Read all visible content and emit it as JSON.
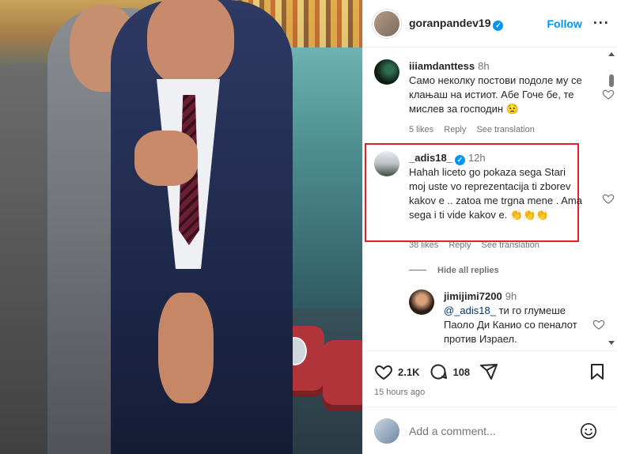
{
  "header": {
    "username": "goranpandev19",
    "follow_label": "Follow",
    "more_label": "···",
    "verified": true
  },
  "comments": [
    {
      "username": "iiiamdanttess",
      "time": "8h",
      "text": "Само неколку постови подоле му се клањаш на истиот. Абе Гоче бе, те мислев за господин 😟",
      "likes": "5 likes",
      "reply_label": "Reply",
      "translate_label": "See translation"
    },
    {
      "username": "_adis18_",
      "verified": true,
      "time": "12h",
      "text": "Hahah liceto go pokaza sega Stari moj uste vo reprezentacija ti zborev kakov e .. zatoa me trgna mene . Ama sega i ti vide kakov e. 👏👏👏",
      "likes": "38 likes",
      "reply_label": "Reply",
      "translate_label": "See translation",
      "highlighted": true,
      "highlight_color": "#e2202b"
    }
  ],
  "hide_replies_label": "Hide all replies",
  "reply": {
    "username": "jimijimi7200",
    "time": "9h",
    "mention": "@_adis18_",
    "text": " ти го глумеше Паоло Ди Канио со пеналот против Израел."
  },
  "actions": {
    "like_count": "2.1K",
    "comment_count": "108",
    "time_ago": "15 hours ago"
  },
  "add_comment": {
    "placeholder": "Add a comment..."
  },
  "colors": {
    "accent": "#0095f6",
    "secondary_text": "#737373",
    "highlight_border": "#e2202b"
  }
}
